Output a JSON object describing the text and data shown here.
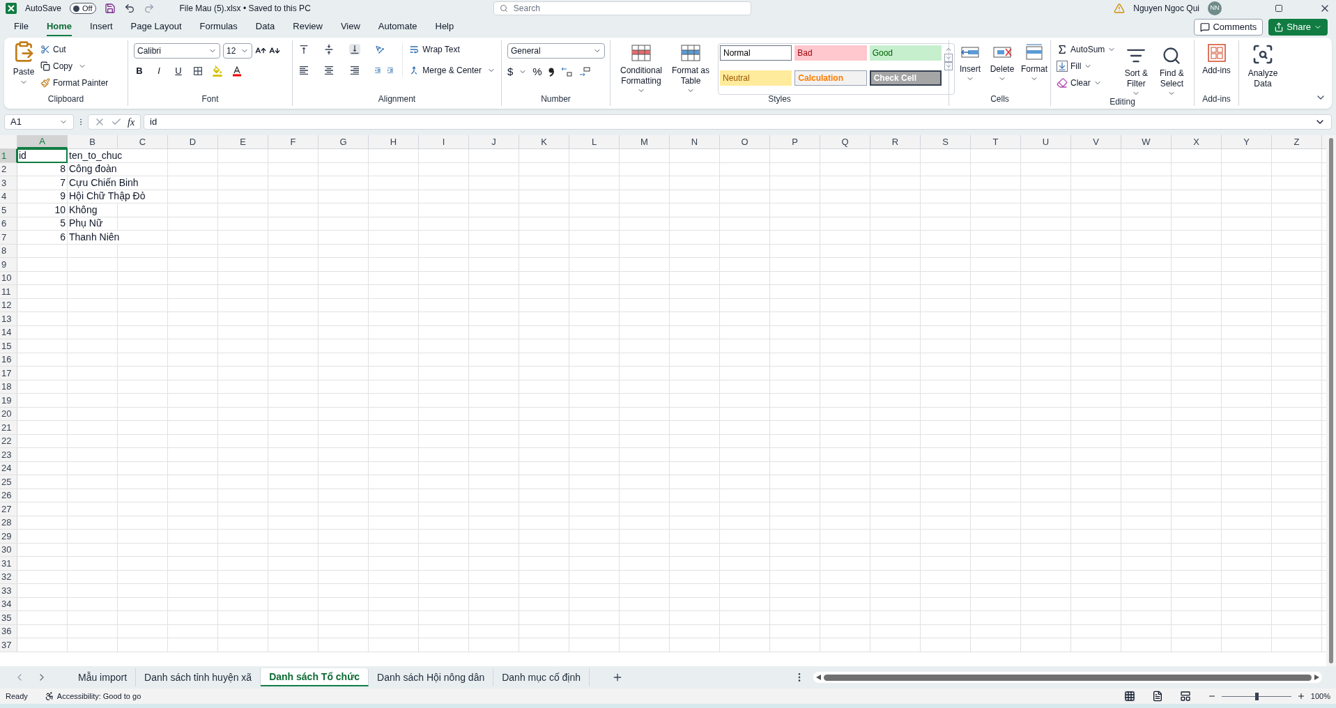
{
  "title_bar": {
    "autosave_label": "AutoSave",
    "autosave_state": "Off",
    "autosave_on": false,
    "file_title": "File Mau (5).xlsx • Saved to this PC",
    "search_placeholder": "Search",
    "user_name": "Nguyen Ngoc Qui",
    "user_initials": "NN"
  },
  "menu_tabs": [
    {
      "label": "File",
      "selected": false
    },
    {
      "label": "Home",
      "selected": true
    },
    {
      "label": "Insert",
      "selected": false
    },
    {
      "label": "Page Layout",
      "selected": false
    },
    {
      "label": "Formulas",
      "selected": false
    },
    {
      "label": "Data",
      "selected": false
    },
    {
      "label": "Review",
      "selected": false
    },
    {
      "label": "View",
      "selected": false
    },
    {
      "label": "Automate",
      "selected": false
    },
    {
      "label": "Help",
      "selected": false
    }
  ],
  "comments_button": "Comments",
  "share_button": "Share",
  "ribbon": {
    "clipboard": {
      "label": "Clipboard",
      "paste": "Paste",
      "cut": "Cut",
      "copy": "Copy",
      "format_painter": "Format Painter"
    },
    "font": {
      "label": "Font",
      "font_name": "Calibri",
      "font_size": "12",
      "bold": "B",
      "italic": "I",
      "underline": "U"
    },
    "alignment": {
      "label": "Alignment",
      "wrap_text": "Wrap Text",
      "merge_center": "Merge & Center"
    },
    "number": {
      "label": "Number",
      "format": "General",
      "currency": "$",
      "percent": "%"
    },
    "styles": {
      "label": "Styles",
      "conditional_formatting": "Conditional Formatting",
      "format_as_table": "Format as Table",
      "cell_styles": [
        {
          "label": "Normal",
          "kind": "normal"
        },
        {
          "label": "Bad",
          "kind": "bad"
        },
        {
          "label": "Good",
          "kind": "good"
        },
        {
          "label": "Neutral",
          "kind": "neutral"
        },
        {
          "label": "Calculation",
          "kind": "calculation"
        },
        {
          "label": "Check Cell",
          "kind": "check"
        }
      ]
    },
    "cells": {
      "label": "Cells",
      "insert": "Insert",
      "delete": "Delete",
      "format": "Format"
    },
    "editing": {
      "label": "Editing",
      "autosum": "AutoSum",
      "fill": "Fill",
      "clear": "Clear",
      "sort_filter": "Sort & Filter",
      "find_select": "Find & Select"
    },
    "addins": {
      "label": "Add-ins",
      "addins_button": "Add-ins"
    },
    "analyze_data": "Analyze Data"
  },
  "formula_bar": {
    "name_box": "A1",
    "function_label": "fx",
    "formula": "id"
  },
  "sheet": {
    "columns": [
      {
        "label": "A",
        "selected": true
      },
      {
        "label": "B",
        "selected": false
      },
      {
        "label": "C",
        "selected": false
      },
      {
        "label": "D",
        "selected": false
      },
      {
        "label": "E",
        "selected": false
      },
      {
        "label": "F",
        "selected": false
      },
      {
        "label": "G",
        "selected": false
      },
      {
        "label": "H",
        "selected": false
      },
      {
        "label": "I",
        "selected": false
      },
      {
        "label": "J",
        "selected": false
      },
      {
        "label": "K",
        "selected": false
      },
      {
        "label": "L",
        "selected": false
      },
      {
        "label": "M",
        "selected": false
      },
      {
        "label": "N",
        "selected": false
      },
      {
        "label": "O",
        "selected": false
      },
      {
        "label": "P",
        "selected": false
      },
      {
        "label": "Q",
        "selected": false
      },
      {
        "label": "R",
        "selected": false
      },
      {
        "label": "S",
        "selected": false
      },
      {
        "label": "T",
        "selected": false
      },
      {
        "label": "U",
        "selected": false
      },
      {
        "label": "V",
        "selected": false
      },
      {
        "label": "W",
        "selected": false
      },
      {
        "label": "X",
        "selected": false
      },
      {
        "label": "Y",
        "selected": false
      },
      {
        "label": "Z",
        "selected": false
      }
    ],
    "rows": [
      {
        "number": "1",
        "selected": true,
        "cells": [
          {
            "value": "id",
            "kind": "text",
            "selected": true
          },
          {
            "value": "ten_to_chuc",
            "kind": "text",
            "selected": false
          }
        ]
      },
      {
        "number": "2",
        "selected": false,
        "cells": [
          {
            "value": "8",
            "kind": "number",
            "selected": false
          },
          {
            "value": "Công đoàn",
            "kind": "text",
            "selected": false
          }
        ]
      },
      {
        "number": "3",
        "selected": false,
        "cells": [
          {
            "value": "7",
            "kind": "number",
            "selected": false
          },
          {
            "value": "Cựu Chiến Binh",
            "kind": "text",
            "selected": false
          }
        ]
      },
      {
        "number": "4",
        "selected": false,
        "cells": [
          {
            "value": "9",
            "kind": "number",
            "selected": false
          },
          {
            "value": "Hội Chữ Thập Đỏ",
            "kind": "text",
            "selected": false
          }
        ]
      },
      {
        "number": "5",
        "selected": false,
        "cells": [
          {
            "value": "10",
            "kind": "number",
            "selected": false
          },
          {
            "value": "Không",
            "kind": "text",
            "selected": false
          }
        ]
      },
      {
        "number": "6",
        "selected": false,
        "cells": [
          {
            "value": "5",
            "kind": "number",
            "selected": false
          },
          {
            "value": "Phụ Nữ",
            "kind": "text",
            "selected": false
          }
        ]
      },
      {
        "number": "7",
        "selected": false,
        "cells": [
          {
            "value": "6",
            "kind": "number",
            "selected": false
          },
          {
            "value": "Thanh Niên",
            "kind": "text",
            "selected": false
          }
        ]
      },
      {
        "number": "8",
        "selected": false
      },
      {
        "number": "9",
        "selected": false
      },
      {
        "number": "10",
        "selected": false
      },
      {
        "number": "11",
        "selected": false
      },
      {
        "number": "12",
        "selected": false
      },
      {
        "number": "13",
        "selected": false
      },
      {
        "number": "14",
        "selected": false
      },
      {
        "number": "15",
        "selected": false
      },
      {
        "number": "16",
        "selected": false
      },
      {
        "number": "17",
        "selected": false
      },
      {
        "number": "18",
        "selected": false
      },
      {
        "number": "19",
        "selected": false
      },
      {
        "number": "20",
        "selected": false
      },
      {
        "number": "21",
        "selected": false
      },
      {
        "number": "22",
        "selected": false
      },
      {
        "number": "23",
        "selected": false
      },
      {
        "number": "24",
        "selected": false
      },
      {
        "number": "25",
        "selected": false
      },
      {
        "number": "26",
        "selected": false
      },
      {
        "number": "27",
        "selected": false
      },
      {
        "number": "28",
        "selected": false
      },
      {
        "number": "29",
        "selected": false
      },
      {
        "number": "30",
        "selected": false
      },
      {
        "number": "31",
        "selected": false
      },
      {
        "number": "32",
        "selected": false
      },
      {
        "number": "33",
        "selected": false
      },
      {
        "number": "34",
        "selected": false
      },
      {
        "number": "35",
        "selected": false
      },
      {
        "number": "36",
        "selected": false
      },
      {
        "number": "37",
        "selected": false
      }
    ]
  },
  "sheet_tabs": [
    {
      "label": "Mẫu import",
      "selected": false
    },
    {
      "label": "Danh sách tỉnh huyện xã",
      "selected": false
    },
    {
      "label": "Danh sách Tổ chức",
      "selected": true
    },
    {
      "label": "Danh sách Hội nông dân",
      "selected": false
    },
    {
      "label": "Danh mục cố định",
      "selected": false
    }
  ],
  "status_bar": {
    "ready": "Ready",
    "accessibility": "Accessibility: Good to go",
    "zoom": "100%",
    "zoom_level": {
      "level": 0.5
    }
  }
}
